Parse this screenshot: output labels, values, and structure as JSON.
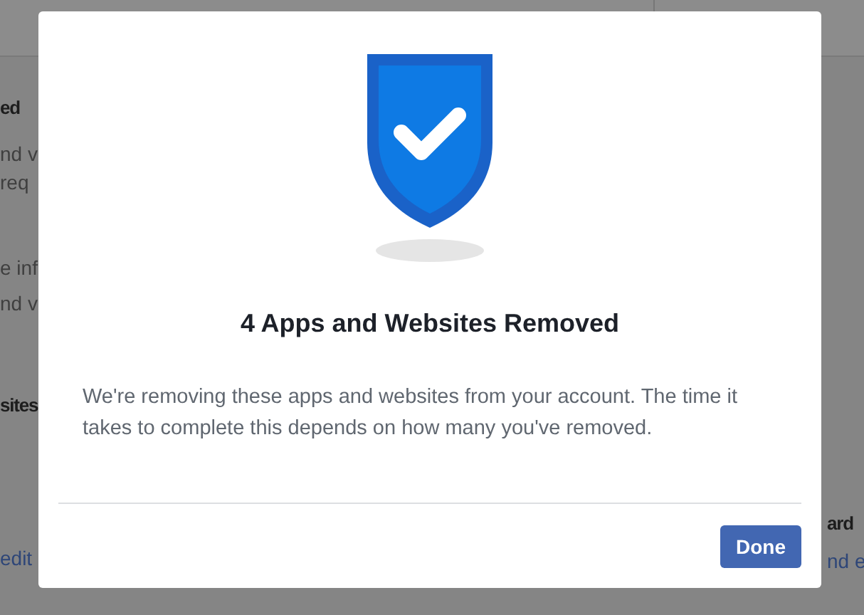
{
  "background": {
    "left_column": [
      {
        "kind": "heading",
        "text": "ed"
      },
      {
        "kind": "body",
        "text": "nd v"
      },
      {
        "kind": "body",
        "text": "req"
      },
      {
        "kind": "body",
        "text": "e inf"
      },
      {
        "kind": "body",
        "text": "nd v"
      },
      {
        "kind": "heading",
        "text": "sites"
      },
      {
        "kind": "link",
        "text": "edit"
      }
    ],
    "right_column": [
      {
        "kind": "heading",
        "text": "ard"
      },
      {
        "kind": "link",
        "text": "nd e"
      }
    ]
  },
  "dialog": {
    "title": "4 Apps and Websites Removed",
    "message": "We're removing these apps and websites from your account. The time it takes to complete this depends on how many you've removed.",
    "buttons": [
      "Done"
    ]
  }
}
